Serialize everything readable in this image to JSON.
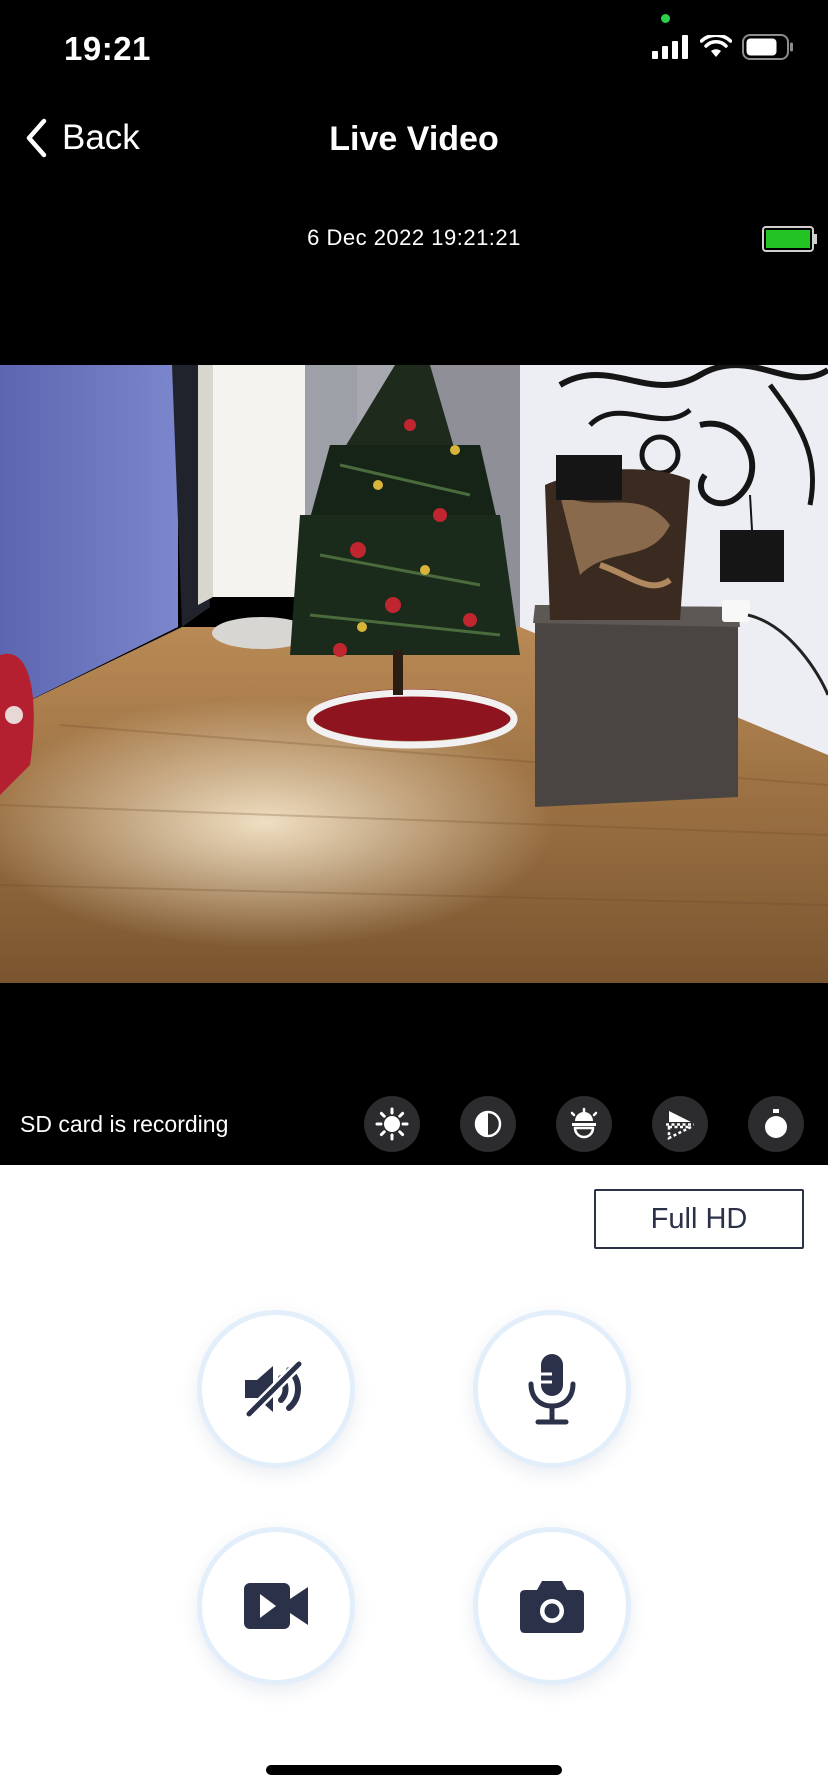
{
  "status_bar": {
    "time": "19:21"
  },
  "nav": {
    "back_label": "Back",
    "title": "Live Video"
  },
  "feed": {
    "timestamp": "6 Dec 2022 19:21:21",
    "battery_level": 1.0
  },
  "recording_status": "SD card is recording",
  "image_controls": [
    {
      "name": "brightness-icon"
    },
    {
      "name": "contrast-icon"
    },
    {
      "name": "exposure-icon"
    },
    {
      "name": "flip-icon"
    },
    {
      "name": "timer-icon"
    }
  ],
  "quality": {
    "label": "Full HD"
  },
  "actions": [
    {
      "name": "speaker-mute-icon"
    },
    {
      "name": "microphone-icon"
    },
    {
      "name": "video-record-icon"
    },
    {
      "name": "camera-snapshot-icon"
    }
  ],
  "colors": {
    "accent": "#2a3149",
    "ring": "#e3eefb",
    "battery": "#22c322"
  }
}
